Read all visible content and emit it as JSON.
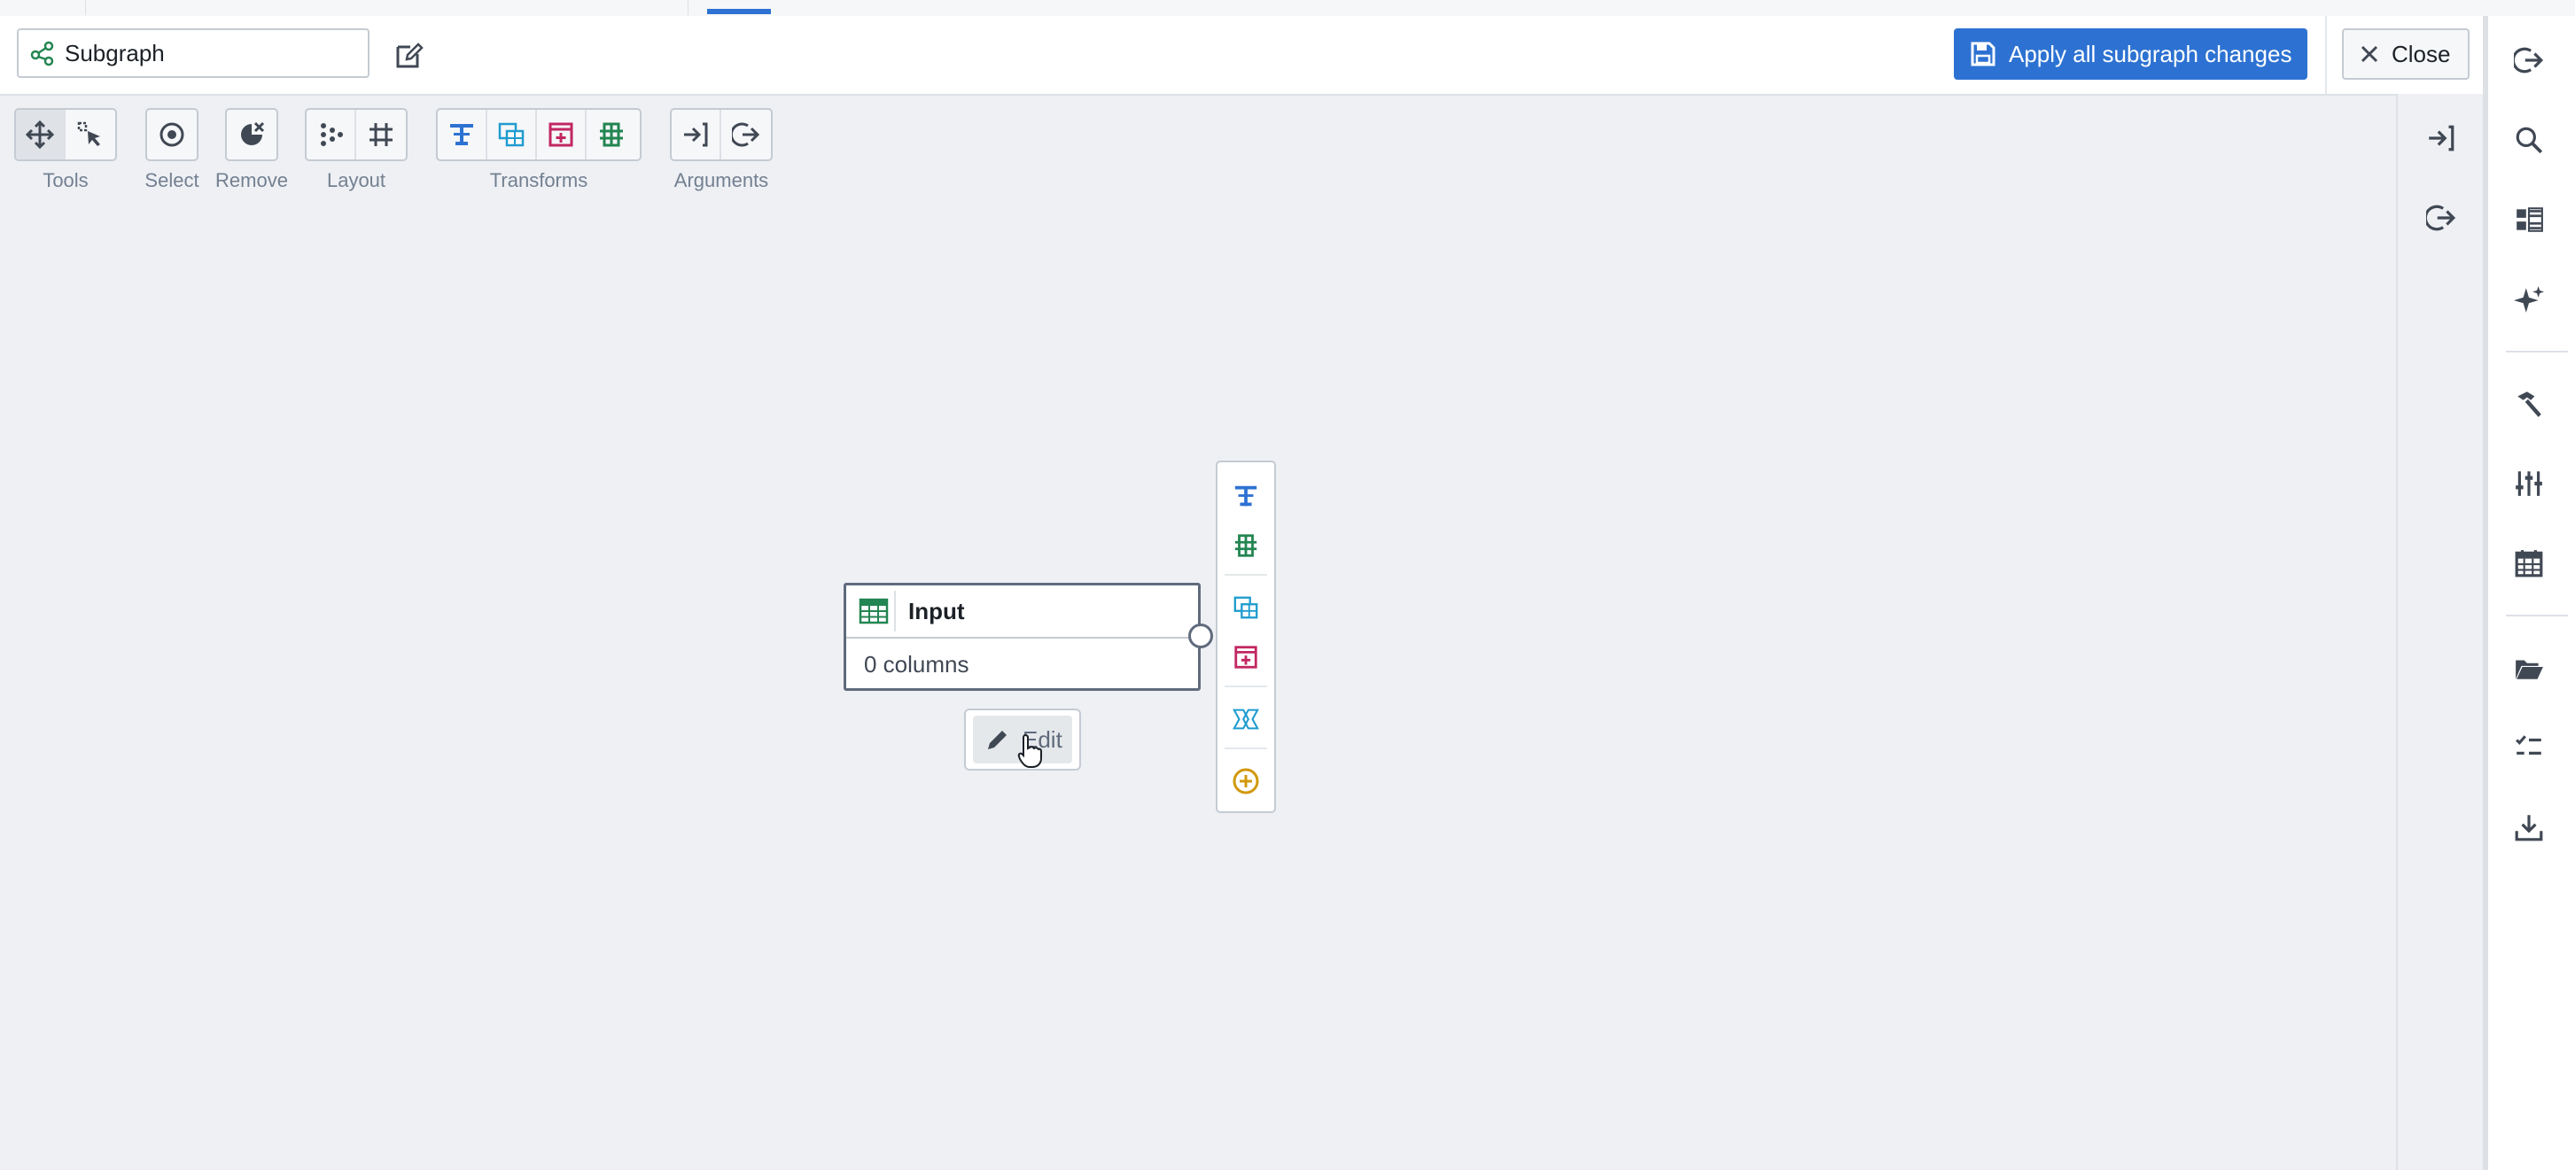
{
  "header": {
    "subgraph_name": "Subgraph",
    "apply_label": "Apply all subgraph changes",
    "close_label": "Close"
  },
  "toolbar": {
    "tools_label": "Tools",
    "select_label": "Select",
    "remove_label": "Remove",
    "layout_label": "Layout",
    "transforms_label": "Transforms",
    "arguments_label": "Arguments"
  },
  "node": {
    "title": "Input",
    "subtitle": "0 columns",
    "edit_label": "Edit"
  },
  "colors": {
    "primary": "#2d72d2",
    "canvas": "#eef0f4",
    "node_border": "#5f6b7c",
    "transform_blue": "#2d72d2",
    "transform_teal": "#1f9ccf",
    "transform_pink": "#c22762",
    "transform_green": "#238551",
    "add_gold": "#d1980b"
  },
  "icons": {
    "subgraph": "subgraph-icon",
    "rename": "edit-icon",
    "apply": "floppy-disk-icon",
    "close": "cross-icon",
    "table": "table-icon"
  }
}
